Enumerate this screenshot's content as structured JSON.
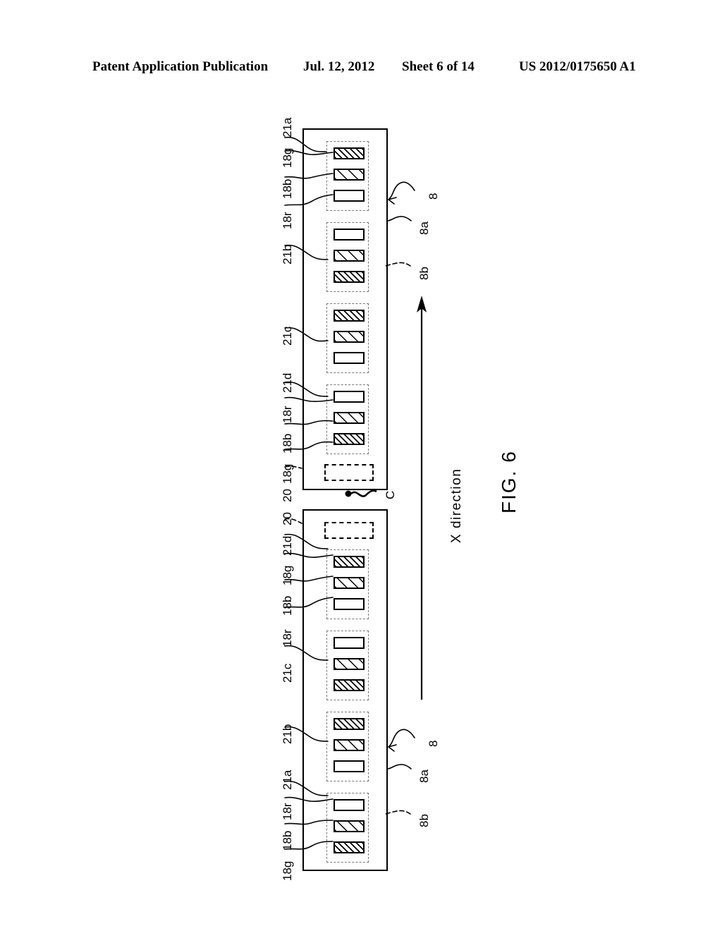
{
  "header": {
    "publication": "Patent Application Publication",
    "date": "Jul. 12, 2012",
    "sheet": "Sheet 6 of 14",
    "patent_number": "US 2012/0175650 A1"
  },
  "figure": {
    "caption": "FIG. 6",
    "axis_label": "X direction",
    "break_marker": "C"
  },
  "labels": {
    "head": "8",
    "head_a": "8a",
    "head_b": "8b",
    "element_20": "20",
    "group_a": "21a",
    "group_b": "21b",
    "group_c": "21c",
    "group_d": "21d",
    "nozzle_r": "18r",
    "nozzle_b": "18b",
    "nozzle_g": "18g"
  },
  "panels": [
    {
      "id": "upper-head",
      "groups": [
        {
          "name": "21a",
          "bars": [
            "18g",
            "18b",
            "18r"
          ]
        },
        {
          "name": "21b",
          "bars": [
            "18r",
            "18b",
            "18g"
          ]
        },
        {
          "name": "21c",
          "bars": [
            "18g",
            "18b",
            "18r"
          ]
        },
        {
          "name": "21d",
          "bars": [
            "18r",
            "18b",
            "18g"
          ]
        }
      ],
      "element_20": "20"
    },
    {
      "id": "lower-head",
      "groups": [
        {
          "name": "21d",
          "bars": [
            "18g",
            "18b",
            "18r"
          ]
        },
        {
          "name": "21c",
          "bars": [
            "18r",
            "18b",
            "18g"
          ]
        },
        {
          "name": "21b",
          "bars": [
            "18g",
            "18b",
            "18r"
          ]
        },
        {
          "name": "21a",
          "bars": [
            "18r",
            "18b",
            "18g"
          ]
        }
      ],
      "element_20": "20"
    }
  ],
  "colors": {
    "ink": "#000000",
    "paper": "#ffffff",
    "dashed_gray": "#777777"
  }
}
